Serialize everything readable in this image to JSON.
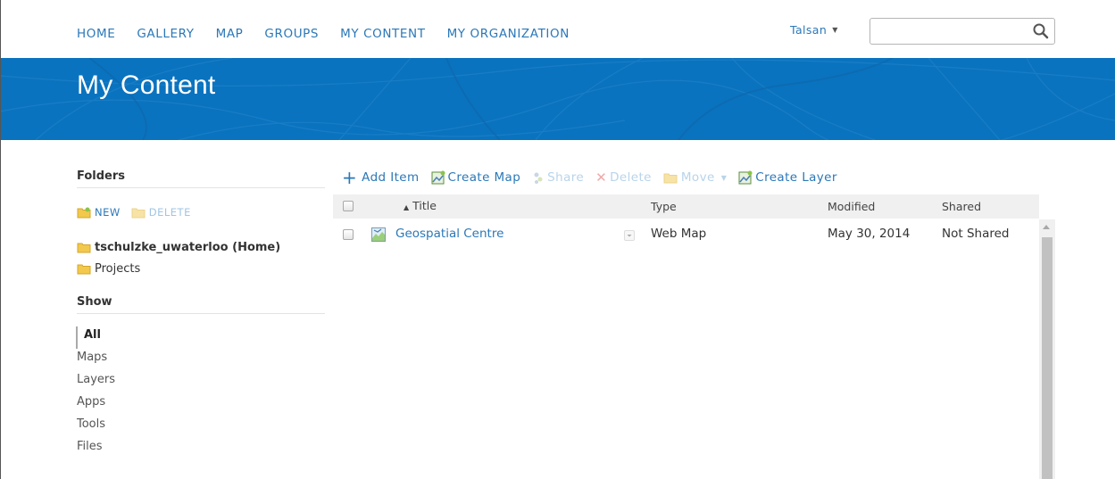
{
  "nav": {
    "links": [
      "HOME",
      "GALLERY",
      "MAP",
      "GROUPS",
      "MY CONTENT",
      "MY ORGANIZATION"
    ],
    "user": "Talsan",
    "search_placeholder": "",
    "search_icon": "search-icon"
  },
  "banner": {
    "title": "My Content"
  },
  "sidebar": {
    "folders_title": "Folders",
    "new_label": "NEW",
    "delete_label": "DELETE",
    "folders": [
      {
        "label": "tschulzke_uwaterloo (Home)"
      },
      {
        "label": "Projects"
      }
    ],
    "show_title": "Show",
    "show_items": [
      {
        "label": "All"
      },
      {
        "label": "Maps"
      },
      {
        "label": "Layers"
      },
      {
        "label": "Apps"
      },
      {
        "label": "Tools"
      },
      {
        "label": "Files"
      }
    ]
  },
  "toolbar": {
    "add_item": "Add Item",
    "create_map": "Create Map",
    "share": "Share",
    "delete": "Delete",
    "move": "Move",
    "create_layer": "Create Layer"
  },
  "table": {
    "columns": {
      "title": "Title",
      "type": "Type",
      "modified": "Modified",
      "shared": "Shared"
    },
    "sort_indicator": "▲",
    "rows": [
      {
        "title": "Geospatial Centre",
        "type": "Web Map",
        "modified": "May 30, 2014",
        "shared": "Not Shared"
      }
    ]
  },
  "colors": {
    "accent": "#2b78b8",
    "banner": "#0a73bf",
    "disabled": "#b8d4ea",
    "folder": "#f2c94c"
  }
}
